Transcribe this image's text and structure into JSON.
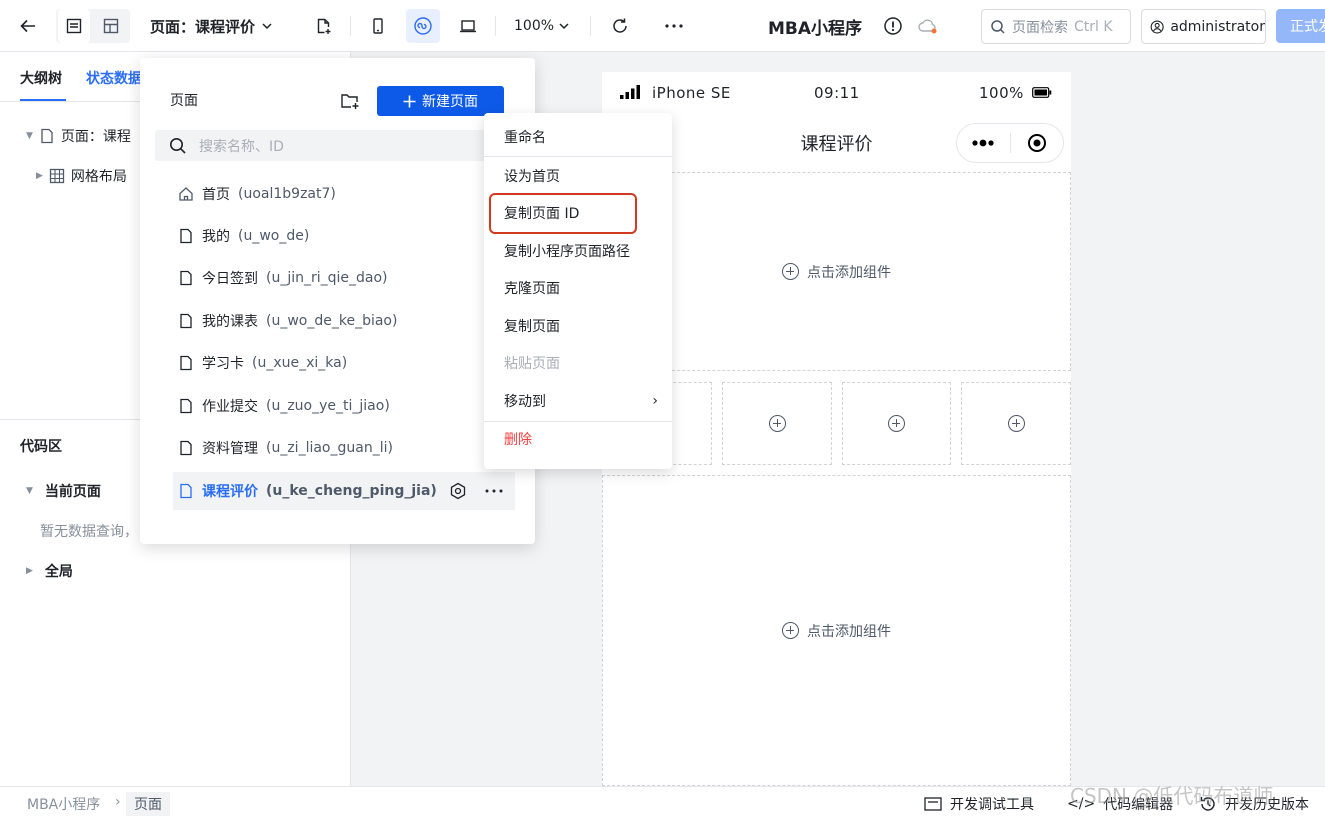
{
  "topbar": {
    "page_select_label": "页面：课程评价",
    "zoom": "100%",
    "app_title": "MBA小程序",
    "search_placeholder": "页面检索",
    "search_shortcut": "Ctrl K",
    "user_name": "administrator",
    "publish_label": "正式发"
  },
  "left_panel": {
    "tabs": [
      "大纲树",
      "状态数据"
    ],
    "tree": {
      "page_node": "页面：课程",
      "grid_node": "网格布局"
    },
    "code_area": {
      "title": "代码区",
      "current_page": "当前页面",
      "empty_text": "暂无数据查询，",
      "global": "全局"
    }
  },
  "pages_popup": {
    "title": "页面",
    "new_page_label": "新建页面",
    "search_placeholder": "搜索名称、ID",
    "pages": [
      {
        "name": "首页",
        "id": "(uoal1b9zat7)",
        "icon": "home-icon"
      },
      {
        "name": "我的",
        "id": "(u_wo_de)",
        "icon": "page-icon"
      },
      {
        "name": "今日签到",
        "id": "(u_jin_ri_qie_dao)",
        "icon": "page-icon"
      },
      {
        "name": "我的课表",
        "id": "(u_wo_de_ke_biao)",
        "icon": "page-icon"
      },
      {
        "name": "学习卡",
        "id": "(u_xue_xi_ka)",
        "icon": "page-icon"
      },
      {
        "name": "作业提交",
        "id": "(u_zuo_ye_ti_jiao)",
        "icon": "page-icon"
      },
      {
        "name": "资料管理",
        "id": "(u_zi_liao_guan_li)",
        "icon": "page-icon"
      },
      {
        "name": "课程评价",
        "id": "(u_ke_cheng_ping_jia)",
        "icon": "page-icon"
      }
    ]
  },
  "context_menu": {
    "items": [
      "重命名",
      "设为首页",
      "复制页面 ID",
      "复制小程序页面路径",
      "克隆页面",
      "复制页面",
      "粘贴页面",
      "移动到",
      "删除"
    ]
  },
  "phone": {
    "device": "iPhone SE",
    "time": "09:11",
    "battery": "100%",
    "nav_title": "课程评价",
    "add_component": "点击添加组件"
  },
  "bottombar": {
    "breadcrumb_app": "MBA小程序",
    "breadcrumb_page": "页面",
    "debug_tools": "开发调试工具",
    "code_editor": "代码编辑器",
    "history": "开发历史版本"
  },
  "watermark": "CSDN @低代码布道师",
  "colors": {
    "primary": "#0e5ae8",
    "link_blue": "#2b6ef6",
    "danger": "#f53f3f",
    "highlight_box": "#d03b1f"
  }
}
